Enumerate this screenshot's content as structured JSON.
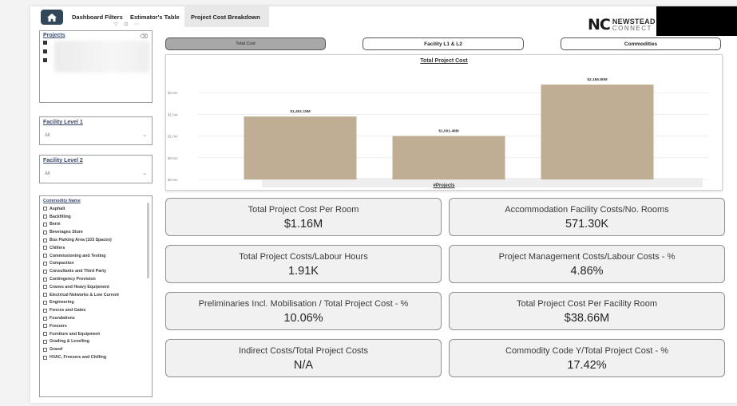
{
  "header": {
    "tabs": [
      {
        "label": "Dashboard Filters"
      },
      {
        "label": "Estimator's Table"
      },
      {
        "label": "Project Cost Breakdown"
      }
    ],
    "logo": {
      "mark": "NC",
      "line1": "NEWSTEAD",
      "line2": "CONNECT"
    }
  },
  "slicers": {
    "projects": {
      "title": "Projects"
    },
    "facility_level_1": {
      "title": "Facility Level 1",
      "value": "All"
    },
    "facility_level_2": {
      "title": "Facility Level 2",
      "value": "All"
    },
    "commodity": {
      "title": "Commodity Name",
      "items": [
        "Asphalt",
        "Backfilling",
        "Berm",
        "Beverages Store",
        "Bus Parking Area (103 Spaces)",
        "Chillers",
        "Commissioning and Testing",
        "Compaction",
        "Consultants and Third Party",
        "Contingency Provision",
        "Cranes and Heavy Equipment",
        "Electrical Networks & Low Current",
        "Engineering",
        "Fences and Gates",
        "Foundations",
        "Freezers",
        "Furniture and Equipment",
        "Grading & Levelling",
        "Gravel",
        "HVAC, Freezers and Chilling"
      ]
    }
  },
  "toggle_buttons": {
    "total_cost": "Total Cost",
    "facility": "Facility L1 & L2",
    "commodities": "Commodities"
  },
  "chart_data": {
    "type": "bar",
    "title": "Total Project Cost",
    "xlabel": "#Projects",
    "ylabel": "",
    "ylim": [
      0,
      2.5
    ],
    "yticks": [
      {
        "v": 0,
        "label": "$0.0m"
      },
      {
        "v": 0.5,
        "label": "$0.5m"
      },
      {
        "v": 1.0,
        "label": "$1.0m"
      },
      {
        "v": 1.5,
        "label": "$1.5m"
      },
      {
        "v": 2.0,
        "label": "$2.0m"
      }
    ],
    "values": [
      1.45115,
      1.00148,
      2.1868
    ],
    "data_labels": [
      "$1,451.15M",
      "$1,001.48M",
      "$2,186.80M"
    ],
    "bar_color": "#bfae93"
  },
  "kpis": [
    {
      "label": "Total Project Cost Per Room",
      "value": "$1.16M"
    },
    {
      "label": "Accommodation Facility Costs/No. Rooms",
      "value": "571.30K"
    },
    {
      "label": "Total Project Costs/Labour Hours",
      "value": "1.91K"
    },
    {
      "label": "Project Management Costs/Labour Costs - %",
      "value": "4.86%"
    },
    {
      "label": "Preliminaries Incl. Mobilisation / Total Project Cost - %",
      "value": "10.06%"
    },
    {
      "label": "Total Project Cost Per Facility Room",
      "value": "$38.66M"
    },
    {
      "label": "Indirect Costs/Total Project Costs",
      "value": "N/A"
    },
    {
      "label": "Commodity Code Y/Total Project Cost - %",
      "value": "17.42%"
    }
  ],
  "colors": {
    "header_dark": "#33475b",
    "bar": "#bfae93",
    "card_bg": "#f1f1f1"
  }
}
